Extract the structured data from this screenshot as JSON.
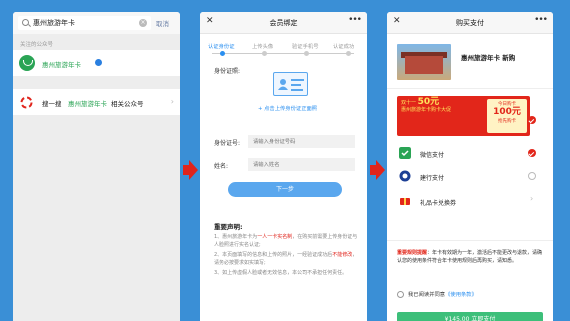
{
  "screen1": {
    "search_query": "惠州旅游年卡",
    "cancel_label": "取消",
    "section_label": "关注的公众号",
    "account_name": "惠州旅游年卡",
    "related": {
      "prefix": "搜一搜",
      "keyword": "惠州旅游年卡",
      "suffix": "相关公众号"
    }
  },
  "screen2": {
    "nav_title": "会员绑定",
    "steps": [
      "认证身份证",
      "上传头像",
      "验证手机号",
      "认证成功"
    ],
    "id_photo_label": "身份证照:",
    "upload_text": "+ 点击上传身份证正面照",
    "id_number_label": "身份证号:",
    "id_number_placeholder": "请输入身份证号码",
    "name_label": "姓名:",
    "name_placeholder": "请输入姓名",
    "next_button": "下一步",
    "declaration_title": "重要声明:",
    "decl1_a": "1、惠州旅游年卡为",
    "decl1_b": "一人一卡实名制",
    "decl1_c": "，在购买前需要上传身份证与人脸照进行实名认证;",
    "decl2_a": "2、本页面填写的信息和上传的照片，一经验证成功后",
    "decl2_b": "不能修改",
    "decl2_c": "，请务必按要求如实填写;",
    "decl3": "3、如上传虚假人脸或者无效信息，本公司不承担任何责任。"
  },
  "screen3": {
    "nav_title": "购买支付",
    "product_name": "惠州旅游年卡 新购",
    "banner_line1": "双十一",
    "banner_big": "50元",
    "banner_line2": "惠州旅游年卡购卡大促",
    "ticket_top": "今日购卡",
    "ticket_big": "100元",
    "ticket_bottom": "抢先购卡",
    "pay_methods": [
      "微信支付",
      "建行支付",
      "礼品卡兑换券"
    ],
    "notice_red": "重要规则提醒",
    "notice_text": "：年卡有效期为一年，激活后不能更改与退款，请确认您的使用条件符合年卡使用规则后再购买，请知悉。",
    "agree_prefix": "我已阅读并同意",
    "agree_link": "《使用条款》",
    "pay_button": "¥145.00 立即支付"
  },
  "colors": {
    "background": "#3a8fd6",
    "wechat_green": "#2aa455",
    "accent_blue": "#2a8ff0",
    "alert_red": "#e2261a"
  }
}
